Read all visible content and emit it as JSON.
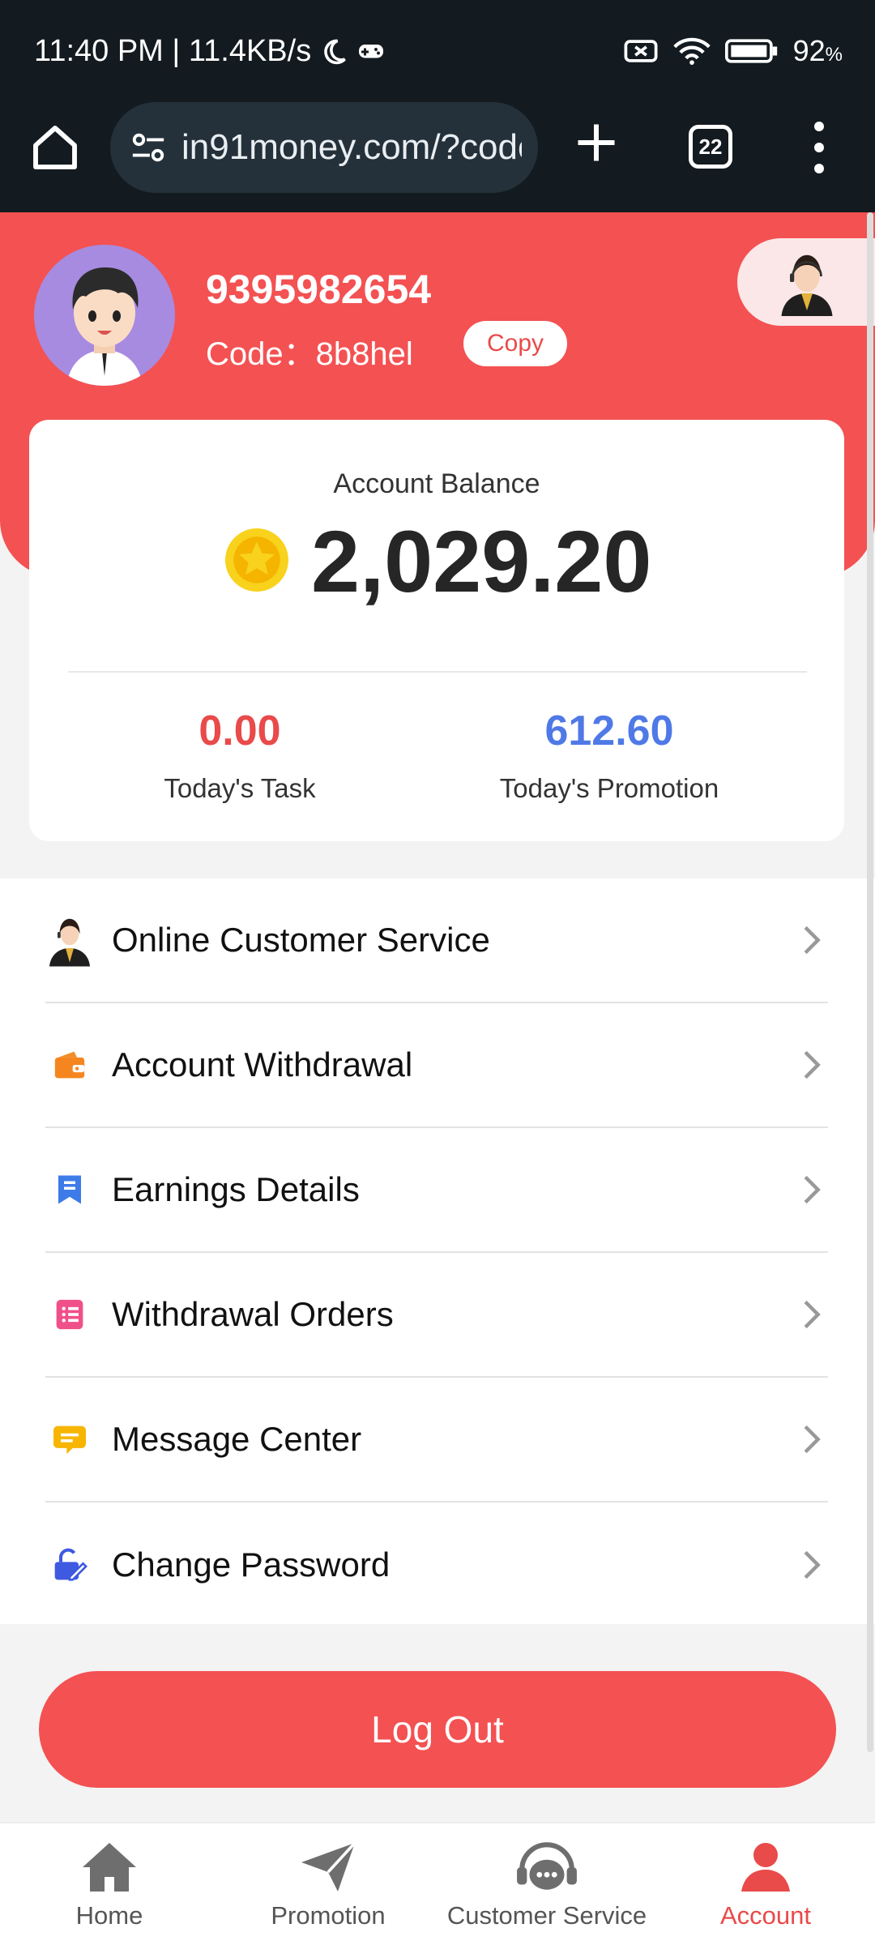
{
  "status_bar": {
    "time_speed": "11:40 PM | 11.4KB/s",
    "battery": "92",
    "battery_unit": "%"
  },
  "browser": {
    "url": "in91money.com/?code",
    "tab_count": "22"
  },
  "profile": {
    "user_id": "9395982654",
    "code_label": "Code：8b8hel",
    "copy_label": "Copy"
  },
  "balance": {
    "label": "Account Balance",
    "value": "2,029.20",
    "today_task_value": "0.00",
    "today_task_label": "Today's Task",
    "today_promotion_value": "612.60",
    "today_promotion_label": "Today's Promotion"
  },
  "menu": [
    {
      "label": "Online Customer Service",
      "icon": "agent-icon"
    },
    {
      "label": "Account Withdrawal",
      "icon": "wallet-icon"
    },
    {
      "label": "Earnings Details",
      "icon": "bookmark-icon"
    },
    {
      "label": "Withdrawal Orders",
      "icon": "list-icon"
    },
    {
      "label": "Message Center",
      "icon": "message-icon"
    },
    {
      "label": "Change Password",
      "icon": "edit-lock-icon"
    }
  ],
  "logout_label": "Log Out",
  "bottom_nav": [
    {
      "label": "Home",
      "icon": "home-icon",
      "active": false
    },
    {
      "label": "Promotion",
      "icon": "paper-plane-icon",
      "active": false
    },
    {
      "label": "Customer Service",
      "icon": "chat-headset-icon",
      "active": false
    },
    {
      "label": "Account",
      "icon": "person-icon",
      "active": true
    }
  ],
  "colors": {
    "brand_red": "#f45152",
    "promo_blue": "#4f79e6",
    "status_bg": "#131b20"
  }
}
